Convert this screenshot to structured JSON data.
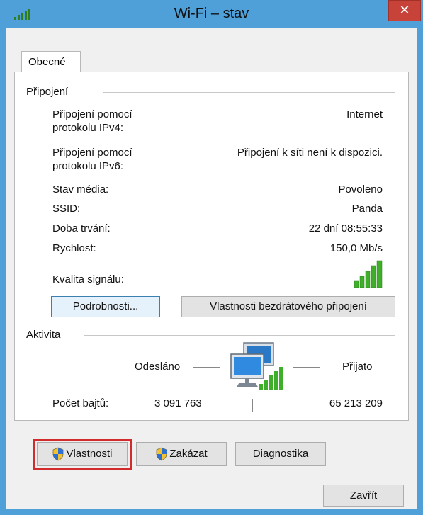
{
  "window": {
    "title": "Wi-Fi – stav",
    "close_label": "✕"
  },
  "tab": {
    "label": "Obecné"
  },
  "connection": {
    "section_label": "Připojení",
    "ipv4_label_1": "Připojení pomocí",
    "ipv4_label_2": "protokolu IPv4:",
    "ipv4_value": "Internet",
    "ipv6_label_1": "Připojení pomocí",
    "ipv6_label_2": "protokolu IPv6:",
    "ipv6_value": "Připojení k síti není k dispozici.",
    "media_label": "Stav média:",
    "media_value": "Povoleno",
    "ssid_label": "SSID:",
    "ssid_value": "Panda",
    "duration_label": "Doba trvání:",
    "duration_value": "22 dní 08:55:33",
    "speed_label": "Rychlost:",
    "speed_value": "150,0 Mb/s",
    "signal_label": "Kvalita signálu:",
    "signal_level": 1.0,
    "details_button": "Podrobnosti...",
    "wireless_props_button": "Vlastnosti bezdrátového připojení"
  },
  "activity": {
    "section_label": "Aktivita",
    "sent_label": "Odesláno",
    "received_label": "Přijato",
    "bytes_label": "Počet bajtů:",
    "bytes_sent": "3 091 763",
    "bytes_received": "65 213 209"
  },
  "buttons": {
    "properties": "Vlastnosti",
    "disable": "Zakázat",
    "diagnostics": "Diagnostika",
    "close": "Zavřít"
  },
  "colors": {
    "frame": "#4fa0d8",
    "close": "#c7433a",
    "highlight": "#d22b2b",
    "signal": "#3fae2b"
  }
}
